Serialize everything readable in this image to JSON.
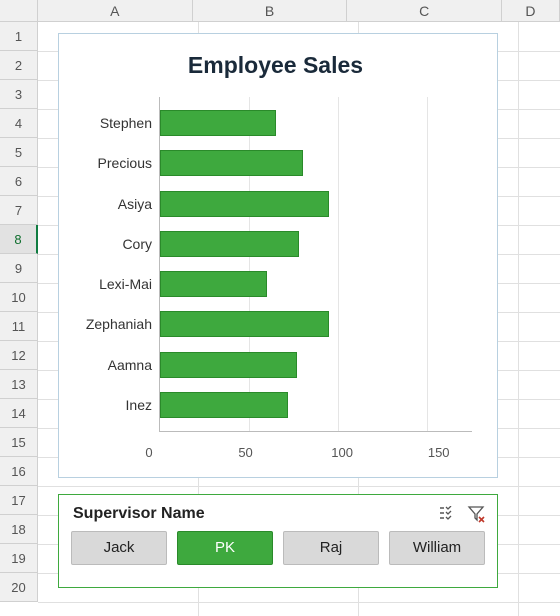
{
  "columns": [
    "A",
    "B",
    "C",
    "D"
  ],
  "rows": [
    "1",
    "2",
    "3",
    "4",
    "5",
    "6",
    "7",
    "8",
    "9",
    "10",
    "11",
    "12",
    "13",
    "14",
    "15",
    "16",
    "17",
    "18",
    "19",
    "20"
  ],
  "selected_row": "8",
  "chart_data": {
    "type": "bar",
    "title": "Employee Sales",
    "xlabel": "",
    "ylabel": "",
    "xlim": [
      0,
      175
    ],
    "ticks": [
      0,
      50,
      100,
      150
    ],
    "categories": [
      "Stephen",
      "Precious",
      "Asiya",
      "Cory",
      "Lexi-Mai",
      "Zephaniah",
      "Aamna",
      "Inez"
    ],
    "values": [
      65,
      80,
      95,
      78,
      60,
      95,
      77,
      72
    ]
  },
  "slicer": {
    "title": "Supervisor Name",
    "options": [
      "Jack",
      "PK",
      "Raj",
      "William"
    ],
    "selected": "PK"
  }
}
